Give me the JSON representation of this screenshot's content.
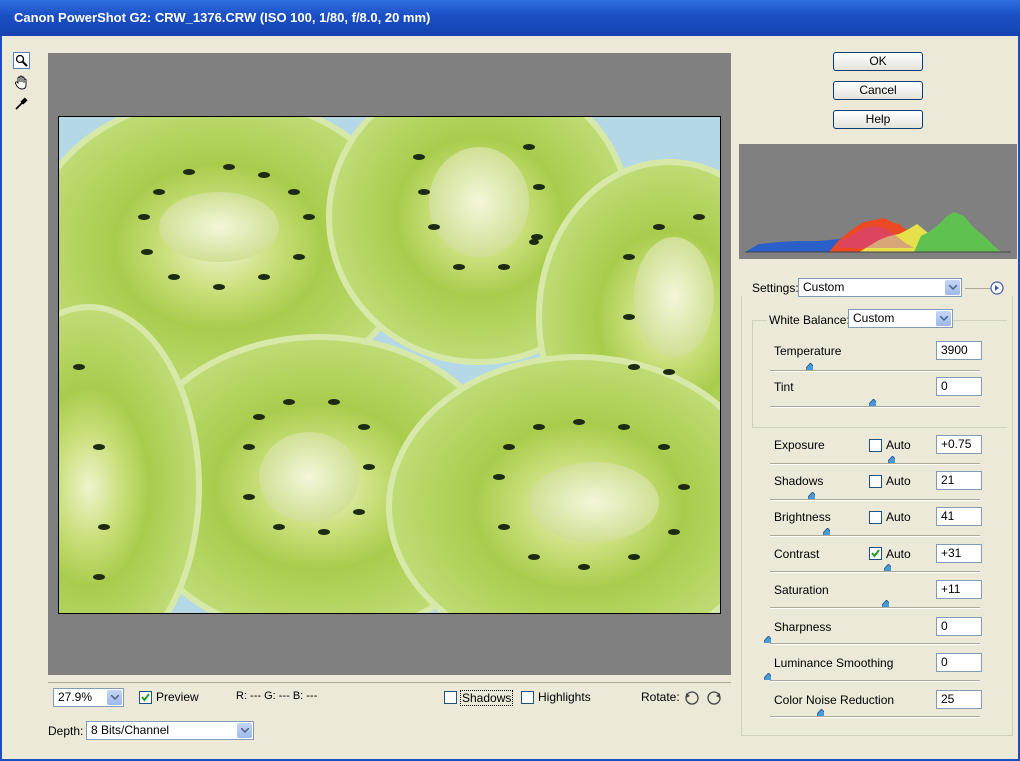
{
  "window": {
    "title": "Canon PowerShot G2:  CRW_1376.CRW  (ISO 100, 1/80, f/8.0, 20 mm)"
  },
  "tools": [
    "zoom-tool",
    "hand-tool",
    "white-balance-eyedropper"
  ],
  "buttons": {
    "ok": "OK",
    "cancel": "Cancel",
    "help": "Help"
  },
  "bottom_bar": {
    "zoom": "27.9%",
    "preview_label": "Preview",
    "preview_checked": true,
    "rgb_readout": "R:  --- G:  --- B:  ---",
    "shadows_label": "Shadows",
    "highlights_label": "Highlights",
    "rotate_label": "Rotate:"
  },
  "depth": {
    "label": "Depth:",
    "value": "8 Bits/Channel"
  },
  "settings": {
    "label": "Settings:",
    "value": "Custom"
  },
  "white_balance": {
    "label": "White Balance:",
    "value": "Custom"
  },
  "adjustments": {
    "temperature": {
      "label": "Temperature",
      "value": "3900",
      "pos": 0.2
    },
    "tint": {
      "label": "Tint",
      "value": "0",
      "pos": 0.5
    },
    "exposure": {
      "label": "Exposure",
      "value": "+0.75",
      "auto_label": "Auto",
      "auto": false,
      "pos": 0.59
    },
    "shadows": {
      "label": "Shadows",
      "value": "21",
      "auto_label": "Auto",
      "auto": false,
      "pos": 0.21
    },
    "brightness": {
      "label": "Brightness",
      "value": "41",
      "auto_label": "Auto",
      "auto": false,
      "pos": 0.28
    },
    "contrast": {
      "label": "Contrast",
      "value": "+31",
      "auto_label": "Auto",
      "auto": true,
      "pos": 0.57
    },
    "saturation": {
      "label": "Saturation",
      "value": "+11",
      "pos": 0.56
    },
    "sharpness": {
      "label": "Sharpness",
      "value": "0",
      "pos": 0.0
    },
    "luminance_smoothing": {
      "label": "Luminance Smoothing",
      "value": "0",
      "pos": 0.0
    },
    "color_noise_reduction": {
      "label": "Color Noise Reduction",
      "value": "25",
      "pos": 0.25
    }
  },
  "colors": {
    "titlebar": "#1a4fc4",
    "preview_bg": "#808080",
    "window_bg": "#ece9d8",
    "histogram_bg": "#808080"
  }
}
